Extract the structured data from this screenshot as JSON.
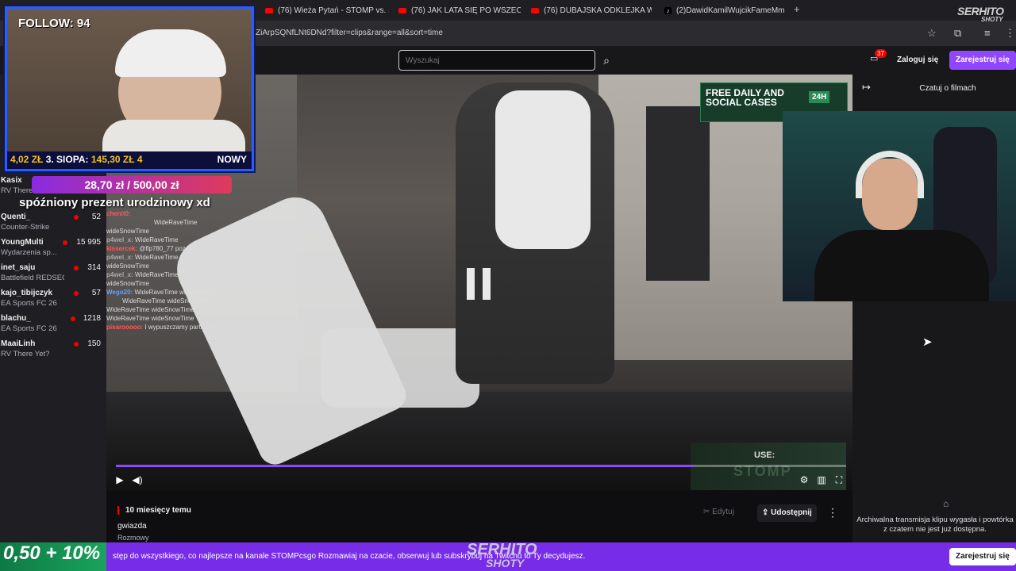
{
  "browser": {
    "tabs": [
      {
        "label": "(76) Wieża Pytań - STOMP vs. M",
        "icon": "youtube-icon"
      },
      {
        "label": "(76) JAK LATA SIĘ PO WSZECH",
        "icon": "youtube-icon"
      },
      {
        "label": "(76) DUBAJSKA ODKLEJKA WE",
        "icon": "youtube-icon"
      },
      {
        "label": "(2)DawidKamilWujcikFameMm",
        "icon": "tiktok-icon"
      }
    ],
    "url": "ZiArpSQNfLNt6DNd?filter=clips&range=all&sort=time"
  },
  "header": {
    "search_placeholder": "Wyszukaj",
    "notifications_count": "37",
    "login_label": "Zaloguj się",
    "signup_label": "Zarejestruj się"
  },
  "sidebar": {
    "channels": [
      {
        "name": "Kasix",
        "game": "RV There",
        "viewers": ""
      },
      {
        "name": "Quenti_",
        "game": "Counter-Strike",
        "viewers": "52"
      },
      {
        "name": "YoungMulti",
        "game": "Wydarzenia sp...",
        "viewers": "15 995"
      },
      {
        "name": "inet_saju",
        "game": "Battlefield REDSEC",
        "viewers": "314"
      },
      {
        "name": "kajo_tibijczyk",
        "game": "EA Sports FC 26",
        "viewers": "57"
      },
      {
        "name": "blachu_",
        "game": "EA Sports FC 26",
        "viewers": "1218"
      },
      {
        "name": "MaaiLinh",
        "game": "RV There Yet?",
        "viewers": "150"
      }
    ]
  },
  "overlay": {
    "follow": "FOLLOW: 94",
    "stats_a": "4,02 ZŁ",
    "stats_b": "3. SIOPA:",
    "stats_c": "145,30 ZŁ",
    "stats_d": "4",
    "stats_new": "NOWY",
    "donation_amount": "28,70 zł / 500,00 zł",
    "donation_message": "spóźniony prezent urodzinowy xd",
    "promo_line1": "FREE DAILY AND",
    "promo_line2": "SOCIAL CASES",
    "promo_line4": "24H",
    "use_label": "USE:",
    "use_code": "STOMP",
    "chat": [
      {
        "user": "chenit0:",
        "msg": ""
      },
      {
        "user": "",
        "msg": "WideRaveTime"
      },
      {
        "user": "",
        "msg": "wideSnowTime"
      },
      {
        "user": "p4wel_x:",
        "msg": "WideRaveTime"
      },
      {
        "user": "kissercek:",
        "msg": "@flp780_77 pozdro"
      },
      {
        "user": "p4wel_x:",
        "msg": "WideRaveTime"
      },
      {
        "user": "",
        "msg": "wideSnowTime"
      },
      {
        "user": "p4wel_x:",
        "msg": "WideRaveTime"
      },
      {
        "user": "",
        "msg": "wideSnowTime"
      },
      {
        "user": "Wego20:",
        "msg": "WideRaveTime wideSnowTime"
      },
      {
        "user": "",
        "msg": "WideRaveTime wideSnowTime"
      },
      {
        "user": "",
        "msg": "WideRaveTime wideSnowTime"
      },
      {
        "user": "",
        "msg": "WideRaveTime wideSnowTime"
      },
      {
        "user": "pisarooooo:",
        "msg": "I wypuszczamy partnerkę"
      }
    ]
  },
  "player": {
    "progress": 0.79
  },
  "right_panel": {
    "title": "Czatuj o filmach",
    "archive_text": "Archiwalna transmisja klipu wygasła i powtórka z czatem nie jest już dostępna."
  },
  "clip": {
    "time_ago": "10 miesięcy temu",
    "title": "gwiazda",
    "category": "Rozmowy",
    "edit_label": "Edytuj",
    "share_label": "Udostępnij"
  },
  "banner": {
    "text": "stęp do wszystkiego, co najlepsze na kanale STOMPcsgo  Rozmawiaj na czacie, obserwuj lub subskrybuj na Twitchu to Ty decydujesz.",
    "button": "Zarejestruj się",
    "promo_overlay": "0,50 + 10%"
  },
  "watermark": {
    "name": "SERHITO",
    "sub": "SHOTY"
  },
  "colors": {
    "accent": "#9147ff",
    "live": "#eb0400",
    "webcam_border": "#2a5cff"
  }
}
